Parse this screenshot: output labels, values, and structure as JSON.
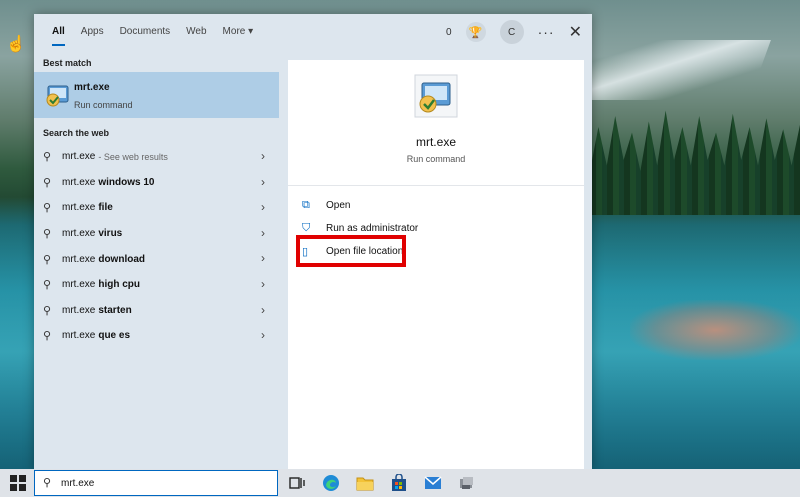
{
  "tabs": [
    {
      "label": "All",
      "active": true
    },
    {
      "label": "Apps"
    },
    {
      "label": "Documents"
    },
    {
      "label": "Web"
    },
    {
      "label": "More ▾"
    }
  ],
  "header": {
    "reward_count": "0",
    "avatar_initial": "C",
    "more_icon": "more-dots-icon",
    "close_icon": "close-icon"
  },
  "best_match": {
    "section_label": "Best match",
    "title": "mrt.exe",
    "subtitle": "Run command"
  },
  "web_search": {
    "section_label": "Search the web",
    "items": [
      {
        "prefix": "mrt.exe",
        "bold": "",
        "hint": "- See web results"
      },
      {
        "prefix": "mrt.exe",
        "bold": "windows 10",
        "hint": ""
      },
      {
        "prefix": "mrt.exe",
        "bold": "file",
        "hint": ""
      },
      {
        "prefix": "mrt.exe",
        "bold": "virus",
        "hint": ""
      },
      {
        "prefix": "mrt.exe",
        "bold": "download",
        "hint": ""
      },
      {
        "prefix": "mrt.exe",
        "bold": "high cpu",
        "hint": ""
      },
      {
        "prefix": "mrt.exe",
        "bold": "starten",
        "hint": ""
      },
      {
        "prefix": "mrt.exe",
        "bold": "que es",
        "hint": ""
      }
    ]
  },
  "detail": {
    "title": "mrt.exe",
    "subtitle": "Run command",
    "actions": [
      {
        "label": "Open",
        "icon": "open-icon"
      },
      {
        "label": "Run as administrator",
        "icon": "shield-icon"
      },
      {
        "label": "Open file location",
        "icon": "file-icon"
      }
    ],
    "highlighted_action": "Open file location",
    "highlight_color": "#e00000"
  },
  "taskbar": {
    "search_value": "mrt.exe",
    "icons": [
      "task-view-icon",
      "edge-icon",
      "file-explorer-icon",
      "store-icon",
      "mail-icon",
      "app-icon"
    ]
  },
  "colors": {
    "accent": "#0067c0",
    "best_match_bg": "#aecde6",
    "panel_bg": "#dde6ee"
  }
}
